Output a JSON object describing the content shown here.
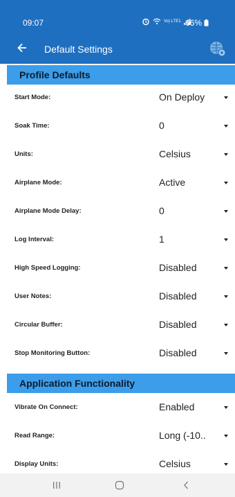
{
  "status_bar": {
    "time": "09:07",
    "battery": "66%",
    "signal_label": "Vo) LTE1"
  },
  "app_bar": {
    "title": "Default Settings"
  },
  "sections": [
    {
      "title": "Profile Defaults",
      "rows": [
        {
          "label": "Start Mode:",
          "value": "On Deploy"
        },
        {
          "label": "Soak Time:",
          "value": "0"
        },
        {
          "label": "Units:",
          "value": "Celsius"
        },
        {
          "label": "Airplane Mode:",
          "value": "Active"
        },
        {
          "label": "Airplane Mode Delay:",
          "value": "0"
        },
        {
          "label": "Log Interval:",
          "value": "1"
        },
        {
          "label": "High Speed Logging:",
          "value": "Disabled"
        },
        {
          "label": "User Notes:",
          "value": "Disabled"
        },
        {
          "label": "Circular Buffer:",
          "value": "Disabled"
        },
        {
          "label": "Stop Monitoring Button:",
          "value": "Disabled"
        }
      ]
    },
    {
      "title": "Application Functionality",
      "rows": [
        {
          "label": "Vibrate On Connect:",
          "value": "Enabled"
        },
        {
          "label": "Read Range:",
          "value": "Long (-10.."
        },
        {
          "label": "Display Units:",
          "value": "Celsius"
        }
      ]
    }
  ],
  "colors": {
    "header_bg": "#1f6fc0",
    "section_bg": "#3c9dea",
    "nav_bg": "#f2f2f2"
  },
  "icons": {
    "back": "arrow-left-icon",
    "settings": "gear-icon",
    "nav_recent": "recent-apps-icon",
    "nav_home": "home-icon",
    "nav_back": "back-chevron-icon"
  }
}
